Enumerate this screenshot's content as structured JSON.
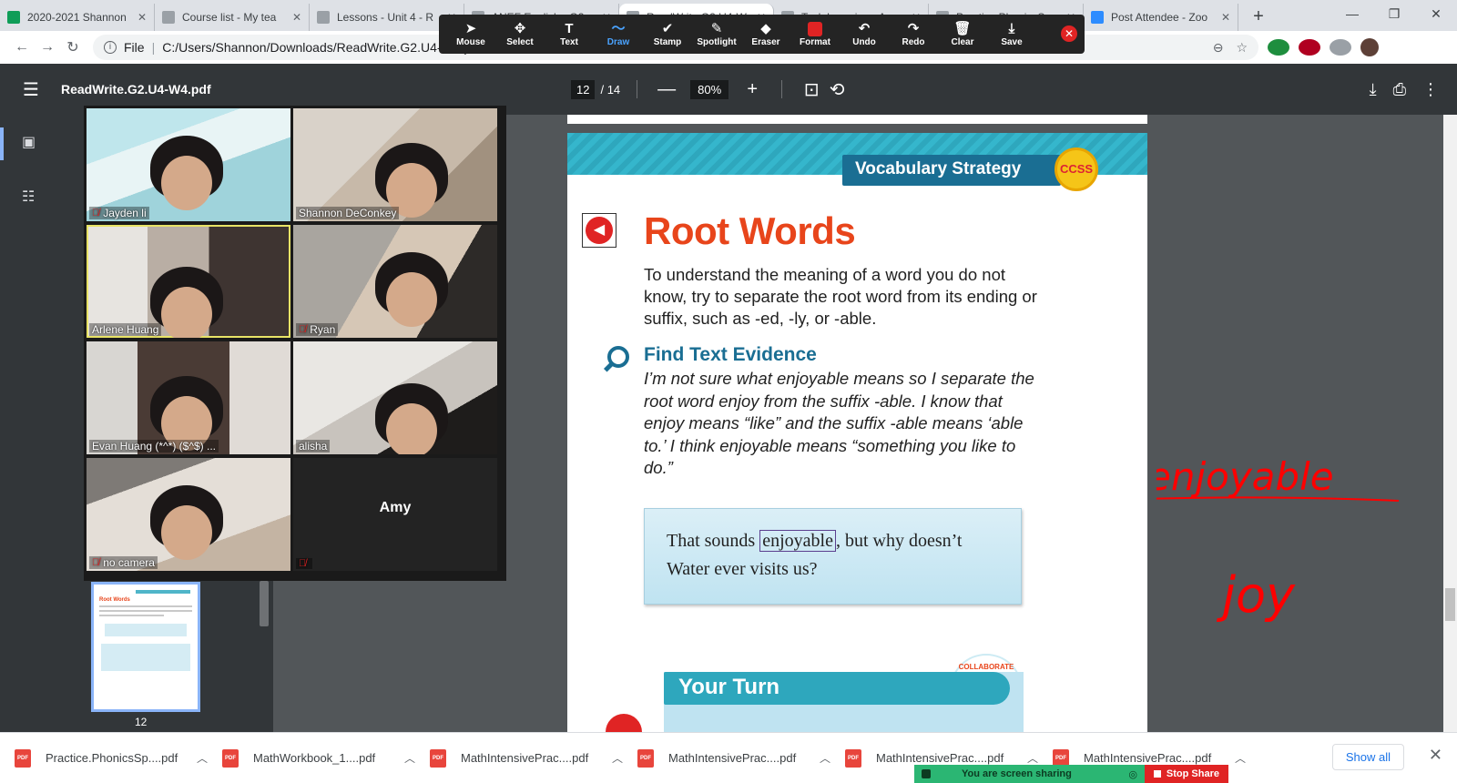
{
  "browser": {
    "tabs": [
      {
        "title": "2020-2021 Shannon",
        "color": "#0f9d58"
      },
      {
        "title": "Course list - My tea",
        "color": "#9aa0a6"
      },
      {
        "title": "Lessons - Unit 4 - R",
        "color": "#9aa0a6"
      },
      {
        "title": "ANEF English - G2",
        "color": "#9aa0a6"
      },
      {
        "title": "ReadWrite.G2.U4-W",
        "color": "#9aa0a6"
      },
      {
        "title": "Task Learning - Ass",
        "color": "#9aa0a6"
      },
      {
        "title": "Practice.PhonicsSp",
        "color": "#9aa0a6"
      },
      {
        "title": "Post Attendee - Zoo",
        "color": "#2d8cff"
      }
    ],
    "address": {
      "scheme": "File",
      "path": "C:/Users/Shannon/Downloads/ReadWrite.G2.U4-W4.pdf"
    }
  },
  "annotate_toolbar": {
    "tools": [
      {
        "label": "Mouse",
        "icon": "cursor-icon",
        "glyph": "➤"
      },
      {
        "label": "Select",
        "icon": "move-icon",
        "glyph": "✥"
      },
      {
        "label": "Text",
        "icon": "text-icon",
        "glyph": "T"
      },
      {
        "label": "Draw",
        "icon": "draw-icon",
        "glyph": "〜"
      },
      {
        "label": "Stamp",
        "icon": "stamp-icon",
        "glyph": "✔"
      },
      {
        "label": "Spotlight",
        "icon": "spotlight-icon",
        "glyph": "✎"
      },
      {
        "label": "Eraser",
        "icon": "eraser-icon",
        "glyph": "◆"
      },
      {
        "label": "Format",
        "icon": "format-icon",
        "glyph": ""
      },
      {
        "label": "Undo",
        "icon": "undo-icon",
        "glyph": "↶"
      },
      {
        "label": "Redo",
        "icon": "redo-icon",
        "glyph": "↷"
      },
      {
        "label": "Clear",
        "icon": "trash-icon",
        "glyph": "🗑"
      },
      {
        "label": "Save",
        "icon": "save-icon",
        "glyph": "⤓"
      }
    ],
    "active": "Draw"
  },
  "pdf_toolbar": {
    "title": "ReadWrite.G2.U4-W4.pdf",
    "page_current": "12",
    "page_total": "/ 14",
    "zoom": "80%"
  },
  "sidebar": {
    "thumb_page": "12",
    "thumb_title": "Root Words"
  },
  "pdf_page": {
    "banner": "Vocabulary Strategy",
    "badge": "CCSS",
    "title": "Root Words",
    "body": "To understand the meaning of a word you do not know, try to separate the root word from its ending or suffix, such as -ed, -ly, or -able.",
    "evidence_heading": "Find Text Evidence",
    "evidence_body": "I’m not sure what enjoyable means so I separate the root word enjoy from the suffix -able. I know that enjoy means “like” and the suffix -able means ‘able to.’ I think enjoyable means “something you like to do.”",
    "quote_before": "That sounds ",
    "quote_highlight": "enjoyable",
    "quote_after": ", but why doesn’t Water ever visits us?",
    "your_turn": "Your Turn",
    "collaborate": "COLLABORATE"
  },
  "annotations": {
    "word1": "enjoyable",
    "word2": "joy",
    "ink_color": "#ff0000"
  },
  "participants": [
    {
      "name": "Jayden li",
      "muted": true
    },
    {
      "name": "Shannon DeConkey",
      "muted": false
    },
    {
      "name": "Arlene Huang",
      "muted": false,
      "speaking": true
    },
    {
      "name": "Ryan",
      "muted": true
    },
    {
      "name": "Evan Huang (*^*) ($^$) ...",
      "muted": false
    },
    {
      "name": "alisha",
      "muted": false
    },
    {
      "name": "no camera",
      "muted": true
    },
    {
      "name": "Amy",
      "muted": true,
      "video_off": true
    }
  ],
  "downloads": [
    "Practice.PhonicsSp....pdf",
    "MathWorkbook_1....pdf",
    "MathIntensivePrac....pdf",
    "MathIntensivePrac....pdf",
    "MathIntensivePrac....pdf",
    "MathIntensivePrac....pdf"
  ],
  "downloads_show_all": "Show all",
  "screen_share": {
    "status": "You are screen sharing",
    "stop": "Stop Share"
  }
}
